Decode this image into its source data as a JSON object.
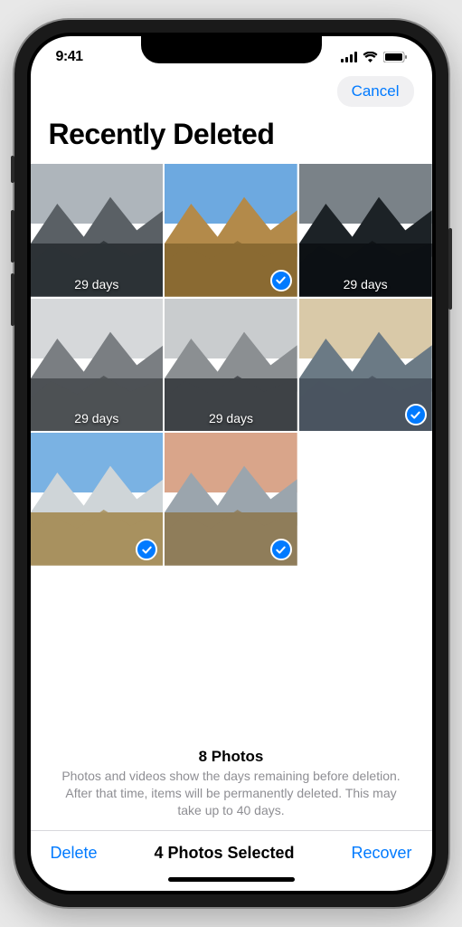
{
  "status": {
    "time": "9:41"
  },
  "header": {
    "cancel_label": "Cancel"
  },
  "title": "Recently Deleted",
  "photos": [
    {
      "days": "29 days",
      "selected": false,
      "palette": "bw-mountain1"
    },
    {
      "days": "",
      "selected": true,
      "palette": "warm-field"
    },
    {
      "days": "29 days",
      "selected": false,
      "palette": "dark-trees"
    },
    {
      "days": "29 days",
      "selected": false,
      "palette": "bw-desert"
    },
    {
      "days": "29 days",
      "selected": false,
      "palette": "bw-snow"
    },
    {
      "days": "",
      "selected": true,
      "palette": "sunset-plain"
    },
    {
      "days": "",
      "selected": true,
      "palette": "peak-grass"
    },
    {
      "days": "",
      "selected": true,
      "palette": "pink-sky"
    }
  ],
  "summary": {
    "count": "8 Photos",
    "description": "Photos and videos show the days remaining before deletion. After that time, items will be permanently deleted. This may take up to 40 days."
  },
  "toolbar": {
    "delete_label": "Delete",
    "selected_label": "4 Photos Selected",
    "recover_label": "Recover"
  }
}
